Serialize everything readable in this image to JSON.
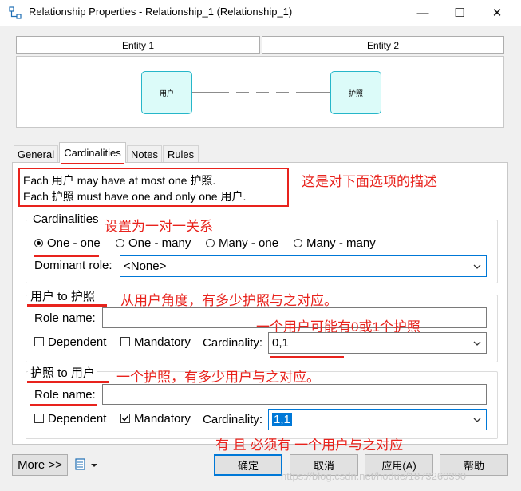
{
  "window": {
    "title": "Relationship Properties - Relationship_1 (Relationship_1)",
    "minimize": "—",
    "maximize": "☐",
    "close": "✕"
  },
  "entities": {
    "entity1_header": "Entity 1",
    "entity2_header": "Entity 2"
  },
  "diagram": {
    "left_entity": "用户",
    "right_entity": "护照"
  },
  "tabs": [
    {
      "label": "General",
      "active": false
    },
    {
      "label": "Cardinalities",
      "active": true
    },
    {
      "label": "Notes",
      "active": false
    },
    {
      "label": "Rules",
      "active": false
    }
  ],
  "description": {
    "line1": "Each 用户 may have at most one 护照.",
    "line2": "Each 护照 must have one and only one 用户."
  },
  "cardinalities": {
    "legend": "Cardinalities",
    "options": [
      "One - one",
      "One - many",
      "Many - one",
      "Many - many"
    ],
    "selected_index": 0,
    "dominant_role_label": "Dominant role:",
    "dominant_role_value": "<None>"
  },
  "role1": {
    "legend": "用户 to 护照",
    "role_name_label": "Role name:",
    "role_name_value": "",
    "dependent_label": "Dependent",
    "dependent_checked": false,
    "mandatory_label": "Mandatory",
    "mandatory_checked": false,
    "cardinality_label": "Cardinality:",
    "cardinality_value": "0,1"
  },
  "role2": {
    "legend": "护照 to 用户",
    "role_name_label": "Role name:",
    "role_name_value": "",
    "dependent_label": "Dependent",
    "dependent_checked": false,
    "mandatory_label": "Mandatory",
    "mandatory_checked": true,
    "cardinality_label": "Cardinality:",
    "cardinality_value": "1,1"
  },
  "buttons": {
    "more": "More >>",
    "ok": "确定",
    "cancel": "取消",
    "apply": "应用(A)",
    "help": "帮助"
  },
  "annotations": {
    "desc_note": "这是对下面选项的描述",
    "cardinality_note": "设置为一对一关系",
    "role1_note": "从用户角度，有多少护照与之对应。",
    "role1_card_note": "一个用户可能有0或1个护照",
    "role2_note": "一个护照，有多少用户与之对应。",
    "role2_card_note": "有 且 必须有 一个用户与之对应",
    "watermark": "https://blog.csdn.net/hodue/1873260390"
  },
  "colors": {
    "annotation_red": "#e8231d",
    "entity_fill": "#dcfbf9",
    "entity_border": "#26b6c9",
    "selection_blue": "#0078d7"
  },
  "icons": [
    "relationship-app-icon",
    "tool-icon",
    "dropdown-arrow-icon",
    "checkmark-icon"
  ]
}
